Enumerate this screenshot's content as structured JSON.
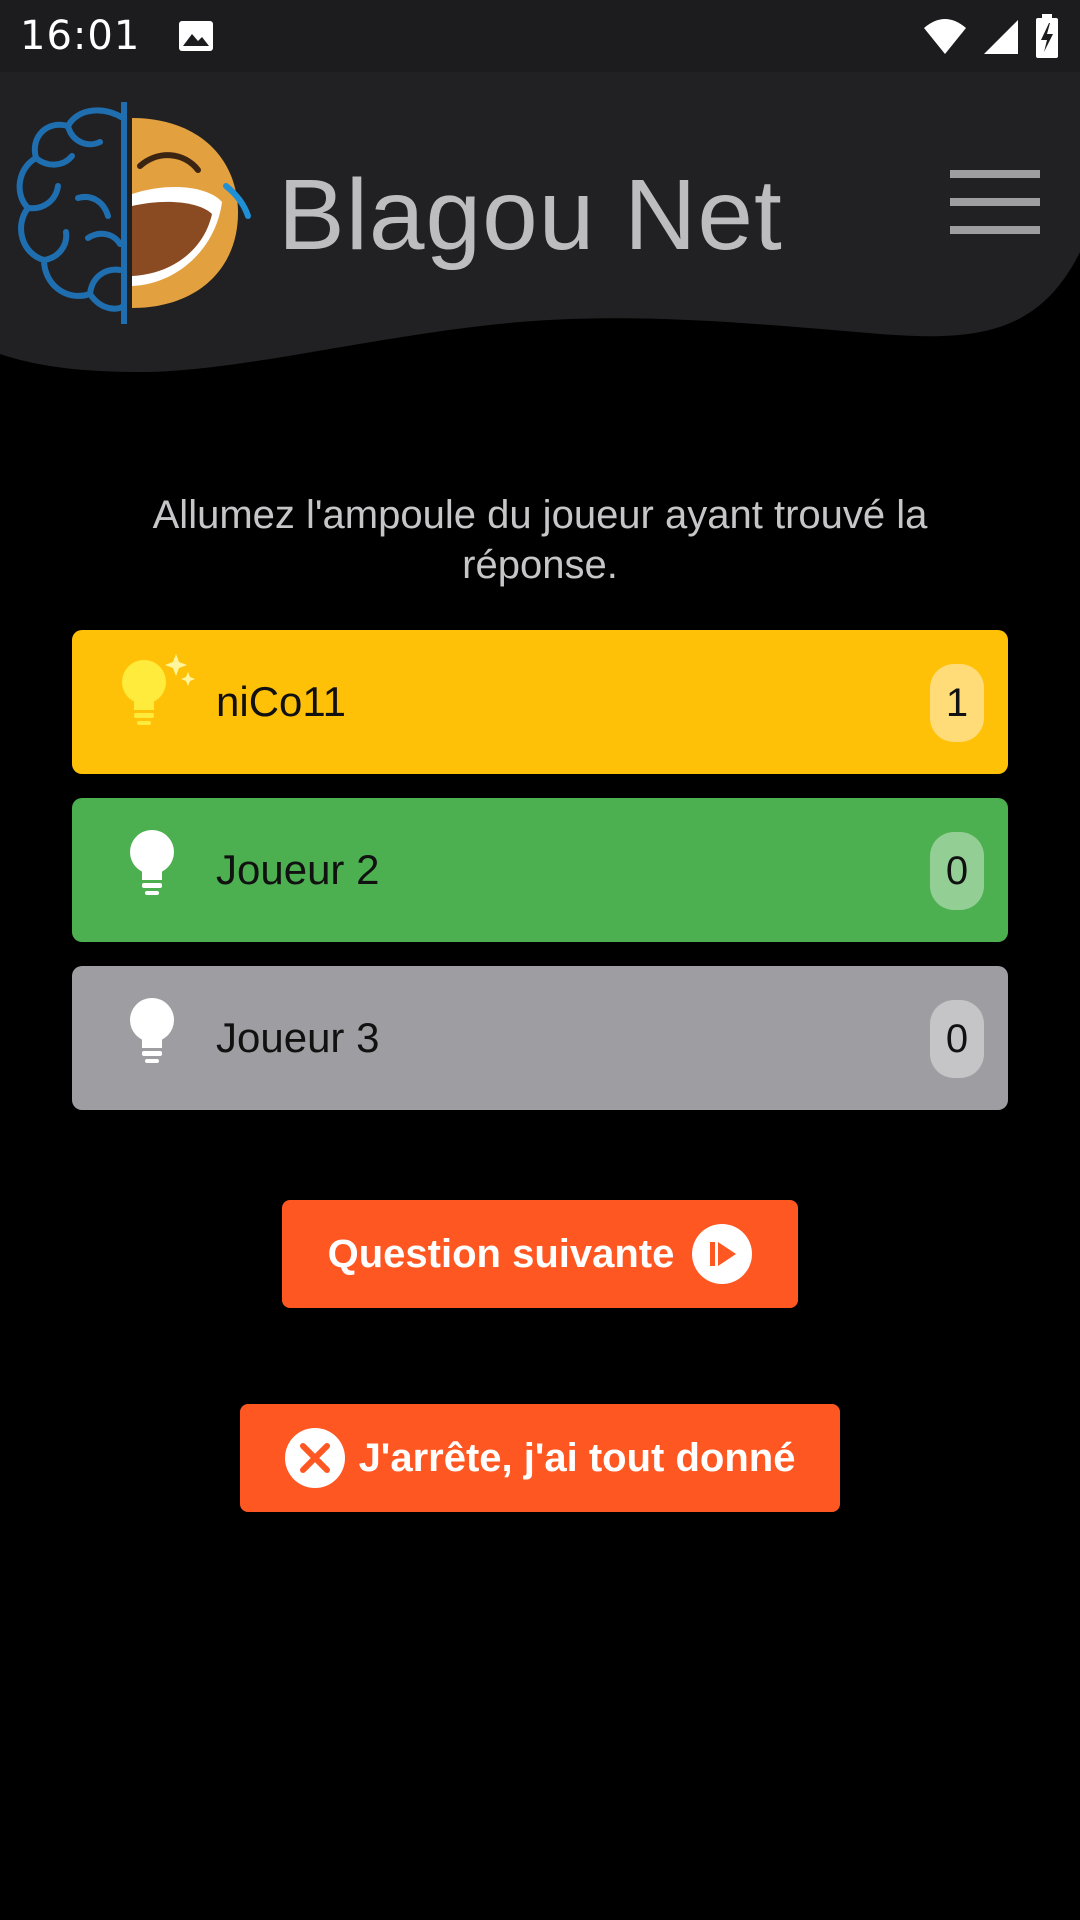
{
  "status_bar": {
    "time": "16:01",
    "icons": [
      "image-icon",
      "wifi-icon",
      "signal-icon",
      "battery-charging-icon"
    ]
  },
  "header": {
    "title": "Blagou Net",
    "logo": "brain-laughing-face-logo",
    "menu_icon": "hamburger-menu-icon"
  },
  "instruction": "Allumez l'ampoule du joueur ayant trouvé la réponse.",
  "players": [
    {
      "name": "niCo11",
      "score": "1",
      "color": "#ffc107",
      "score_bg": "#ffdc78",
      "bulb_lit": true
    },
    {
      "name": "Joueur 2",
      "score": "0",
      "color": "#4caf50",
      "score_bg": "#93cf95",
      "bulb_lit": false
    },
    {
      "name": "Joueur 3",
      "score": "0",
      "color": "#9e9da1",
      "score_bg": "#c5c4c7",
      "bulb_lit": false
    }
  ],
  "buttons": {
    "next_question": "Question suivante",
    "give_up": "J'arrête, j'ai tout donné"
  },
  "colors": {
    "accent": "#ff5722",
    "header_bg": "#212123",
    "background": "#000000"
  }
}
